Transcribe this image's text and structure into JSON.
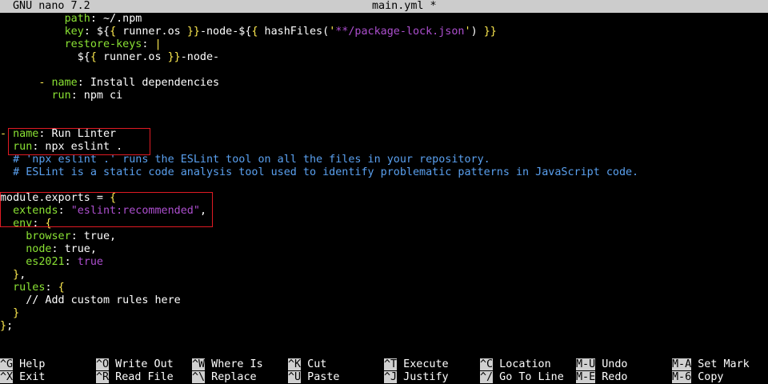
{
  "titlebar": {
    "app": "GNU nano 7.2",
    "file": "main.yml *"
  },
  "editor": {
    "lines": [
      {
        "indent": "          ",
        "parts": [
          [
            "k",
            "path"
          ],
          [
            "w",
            ": ~/.npm"
          ]
        ]
      },
      {
        "indent": "          ",
        "parts": [
          [
            "k",
            "key"
          ],
          [
            "w",
            ": ${"
          ],
          [
            "p",
            "{"
          ],
          [
            "w",
            " runner.os "
          ],
          [
            "p",
            "}}"
          ],
          [
            "w",
            "-node-${"
          ],
          [
            "p",
            "{"
          ],
          [
            "w",
            " hashFiles("
          ],
          [
            "p",
            "'"
          ],
          [
            "s",
            "**/package-lock.json"
          ],
          [
            "p",
            "'"
          ],
          [
            "w",
            ") "
          ],
          [
            "p",
            "}}"
          ]
        ]
      },
      {
        "indent": "          ",
        "parts": [
          [
            "k",
            "restore-keys"
          ],
          [
            "w",
            ": "
          ],
          [
            "p",
            "|"
          ]
        ]
      },
      {
        "indent": "            ",
        "parts": [
          [
            "w",
            "${"
          ],
          [
            "p",
            "{"
          ],
          [
            "w",
            " runner.os "
          ],
          [
            "p",
            "}}"
          ],
          [
            "w",
            "-node-"
          ]
        ]
      },
      {
        "indent": "",
        "parts": []
      },
      {
        "indent": "      ",
        "parts": [
          [
            "p",
            "- "
          ],
          [
            "k",
            "name"
          ],
          [
            "w",
            ": Install dependencies"
          ]
        ]
      },
      {
        "indent": "        ",
        "parts": [
          [
            "k",
            "run"
          ],
          [
            "w",
            ": npm ci"
          ]
        ]
      },
      {
        "indent": "",
        "parts": []
      },
      {
        "indent": "",
        "parts": []
      },
      {
        "indent": "",
        "parts": [
          [
            "p",
            "- "
          ],
          [
            "k",
            "name"
          ],
          [
            "w",
            ": Run Linter"
          ]
        ]
      },
      {
        "indent": "  ",
        "parts": [
          [
            "k",
            "run"
          ],
          [
            "w",
            ": npx eslint ."
          ]
        ]
      },
      {
        "indent": "  ",
        "parts": [
          [
            "c",
            "# 'npx eslint .' runs the ESLint tool on all the files in your repository."
          ]
        ]
      },
      {
        "indent": "  ",
        "parts": [
          [
            "c",
            "# ESLint is a static code analysis tool used to identify problematic patterns in JavaScript code."
          ]
        ]
      },
      {
        "indent": "",
        "parts": []
      },
      {
        "indent": "",
        "parts": [
          [
            "w",
            "module.exports = "
          ],
          [
            "p",
            "{"
          ]
        ]
      },
      {
        "indent": "  ",
        "parts": [
          [
            "k",
            "extends"
          ],
          [
            "w",
            ": "
          ],
          [
            "s",
            "\"eslint:recommended\""
          ],
          [
            "w",
            ","
          ]
        ]
      },
      {
        "indent": "  ",
        "parts": [
          [
            "k",
            "env"
          ],
          [
            "w",
            ": "
          ],
          [
            "p",
            "{"
          ]
        ]
      },
      {
        "indent": "    ",
        "parts": [
          [
            "k",
            "browser"
          ],
          [
            "w",
            ": true,"
          ]
        ]
      },
      {
        "indent": "    ",
        "parts": [
          [
            "k",
            "node"
          ],
          [
            "w",
            ": true,"
          ]
        ]
      },
      {
        "indent": "    ",
        "parts": [
          [
            "k",
            "es2021"
          ],
          [
            "w",
            ": "
          ],
          [
            "s",
            "true"
          ]
        ]
      },
      {
        "indent": "  ",
        "parts": [
          [
            "p",
            "}"
          ],
          [
            "w",
            ","
          ]
        ]
      },
      {
        "indent": "  ",
        "parts": [
          [
            "k",
            "rules"
          ],
          [
            "w",
            ": "
          ],
          [
            "p",
            "{"
          ]
        ]
      },
      {
        "indent": "    ",
        "parts": [
          [
            "w",
            "// Add custom rules here"
          ]
        ]
      },
      {
        "indent": "  ",
        "parts": [
          [
            "p",
            "}"
          ]
        ]
      },
      {
        "indent": "",
        "parts": [
          [
            "p",
            "}"
          ],
          [
            "w",
            ";"
          ]
        ]
      }
    ]
  },
  "shortcuts": [
    {
      "key": "^G",
      "label": "Help"
    },
    {
      "key": "^O",
      "label": "Write Out"
    },
    {
      "key": "^W",
      "label": "Where Is"
    },
    {
      "key": "^K",
      "label": "Cut"
    },
    {
      "key": "^T",
      "label": "Execute"
    },
    {
      "key": "^C",
      "label": "Location"
    },
    {
      "key": "M-U",
      "label": "Undo"
    },
    {
      "key": "M-A",
      "label": "Set Mark"
    },
    {
      "key": "^X",
      "label": "Exit"
    },
    {
      "key": "^R",
      "label": "Read File"
    },
    {
      "key": "^\\",
      "label": "Replace"
    },
    {
      "key": "^U",
      "label": "Paste"
    },
    {
      "key": "^J",
      "label": "Justify"
    },
    {
      "key": "^/",
      "label": "Go To Line"
    },
    {
      "key": "M-E",
      "label": "Redo"
    },
    {
      "key": "M-6",
      "label": "Copy"
    }
  ]
}
